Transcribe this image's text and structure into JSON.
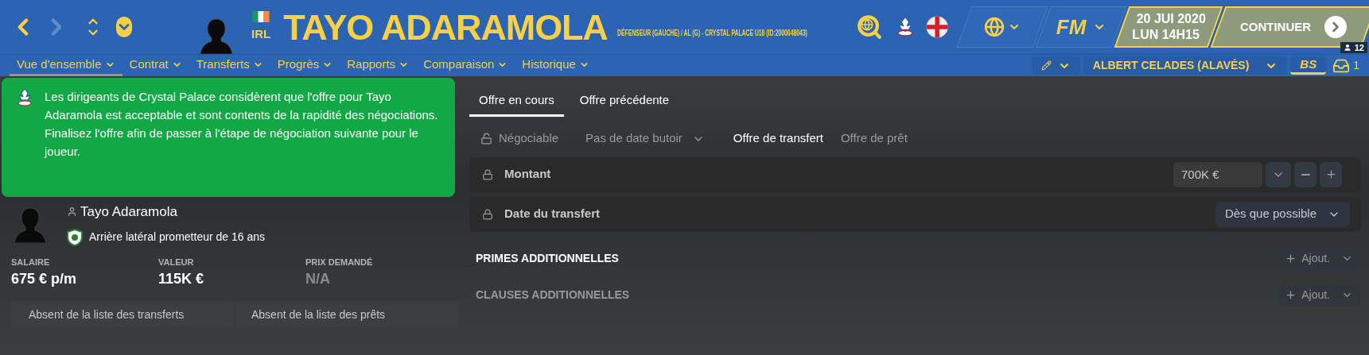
{
  "header": {
    "name": "TAYO ADARAMOLA",
    "nationality": "IRL",
    "subtitle": "DÉFENSEUR (GAUCHE) / AL (G) - CRYSTAL PALACE U18 (ID:2000048043)",
    "fm": "FM",
    "date": "20 JUI 2020",
    "time": "LUN 14H15",
    "continue": "CONTINUER",
    "users": "12"
  },
  "nav": [
    {
      "label": "Vue d'ensemble",
      "selected": true
    },
    {
      "label": "Contrat",
      "selected": false
    },
    {
      "label": "Transferts",
      "selected": false
    },
    {
      "label": "Progrès",
      "selected": false
    },
    {
      "label": "Rapports",
      "selected": false
    },
    {
      "label": "Comparaison",
      "selected": false
    },
    {
      "label": "Historique",
      "selected": false
    }
  ],
  "manager": "ALBERT CELADES (ALAVÉS)",
  "bs": "BS",
  "inbox_count": "1",
  "notice": [
    "Les dirigeants de Crystal Palace considèrent que l'offre pour Tayo Adaramola est acceptable et sont contents de la rapidité des négociations.",
    "Finalisez l'offre afin de passer à l'étape de négociation suivante pour le joueur."
  ],
  "player": {
    "name": "Tayo Adaramola",
    "description": "Arrière latéral prometteur de 16 ans"
  },
  "stats": [
    {
      "label": "SALAIRE",
      "value": "675 € p/m",
      "disabled": false
    },
    {
      "label": "VALEUR",
      "value": "115K €",
      "disabled": false
    },
    {
      "label": "PRIX DEMANDÉ",
      "value": "N/A",
      "disabled": true
    }
  ],
  "listing": [
    "Absent de la liste des transferts",
    "Absent de la liste des prêts"
  ],
  "offer_tabs": [
    {
      "label": "Offre en cours",
      "selected": true
    },
    {
      "label": "Offre précédente",
      "selected": false
    }
  ],
  "options": [
    {
      "label": "Négociable",
      "kind": "lock"
    },
    {
      "label": "Pas de date butoir",
      "kind": "dropdown"
    },
    {
      "label": "Offre de transfert",
      "kind": "toggle",
      "selected": true
    },
    {
      "label": "Offre de prêt",
      "kind": "toggle",
      "selected": false
    }
  ],
  "fields": [
    {
      "label": "Montant",
      "kind": "amount",
      "value": "700K €"
    },
    {
      "label": "Date du transfert",
      "kind": "select",
      "value": "Dès que possible"
    }
  ],
  "sections": [
    {
      "title": "PRIMES ADDITIONNELLES",
      "action": "Ajout.",
      "disabled": false
    },
    {
      "title": "CLAUSES ADDITIONNELLES",
      "action": "Ajout.",
      "disabled": true
    }
  ]
}
